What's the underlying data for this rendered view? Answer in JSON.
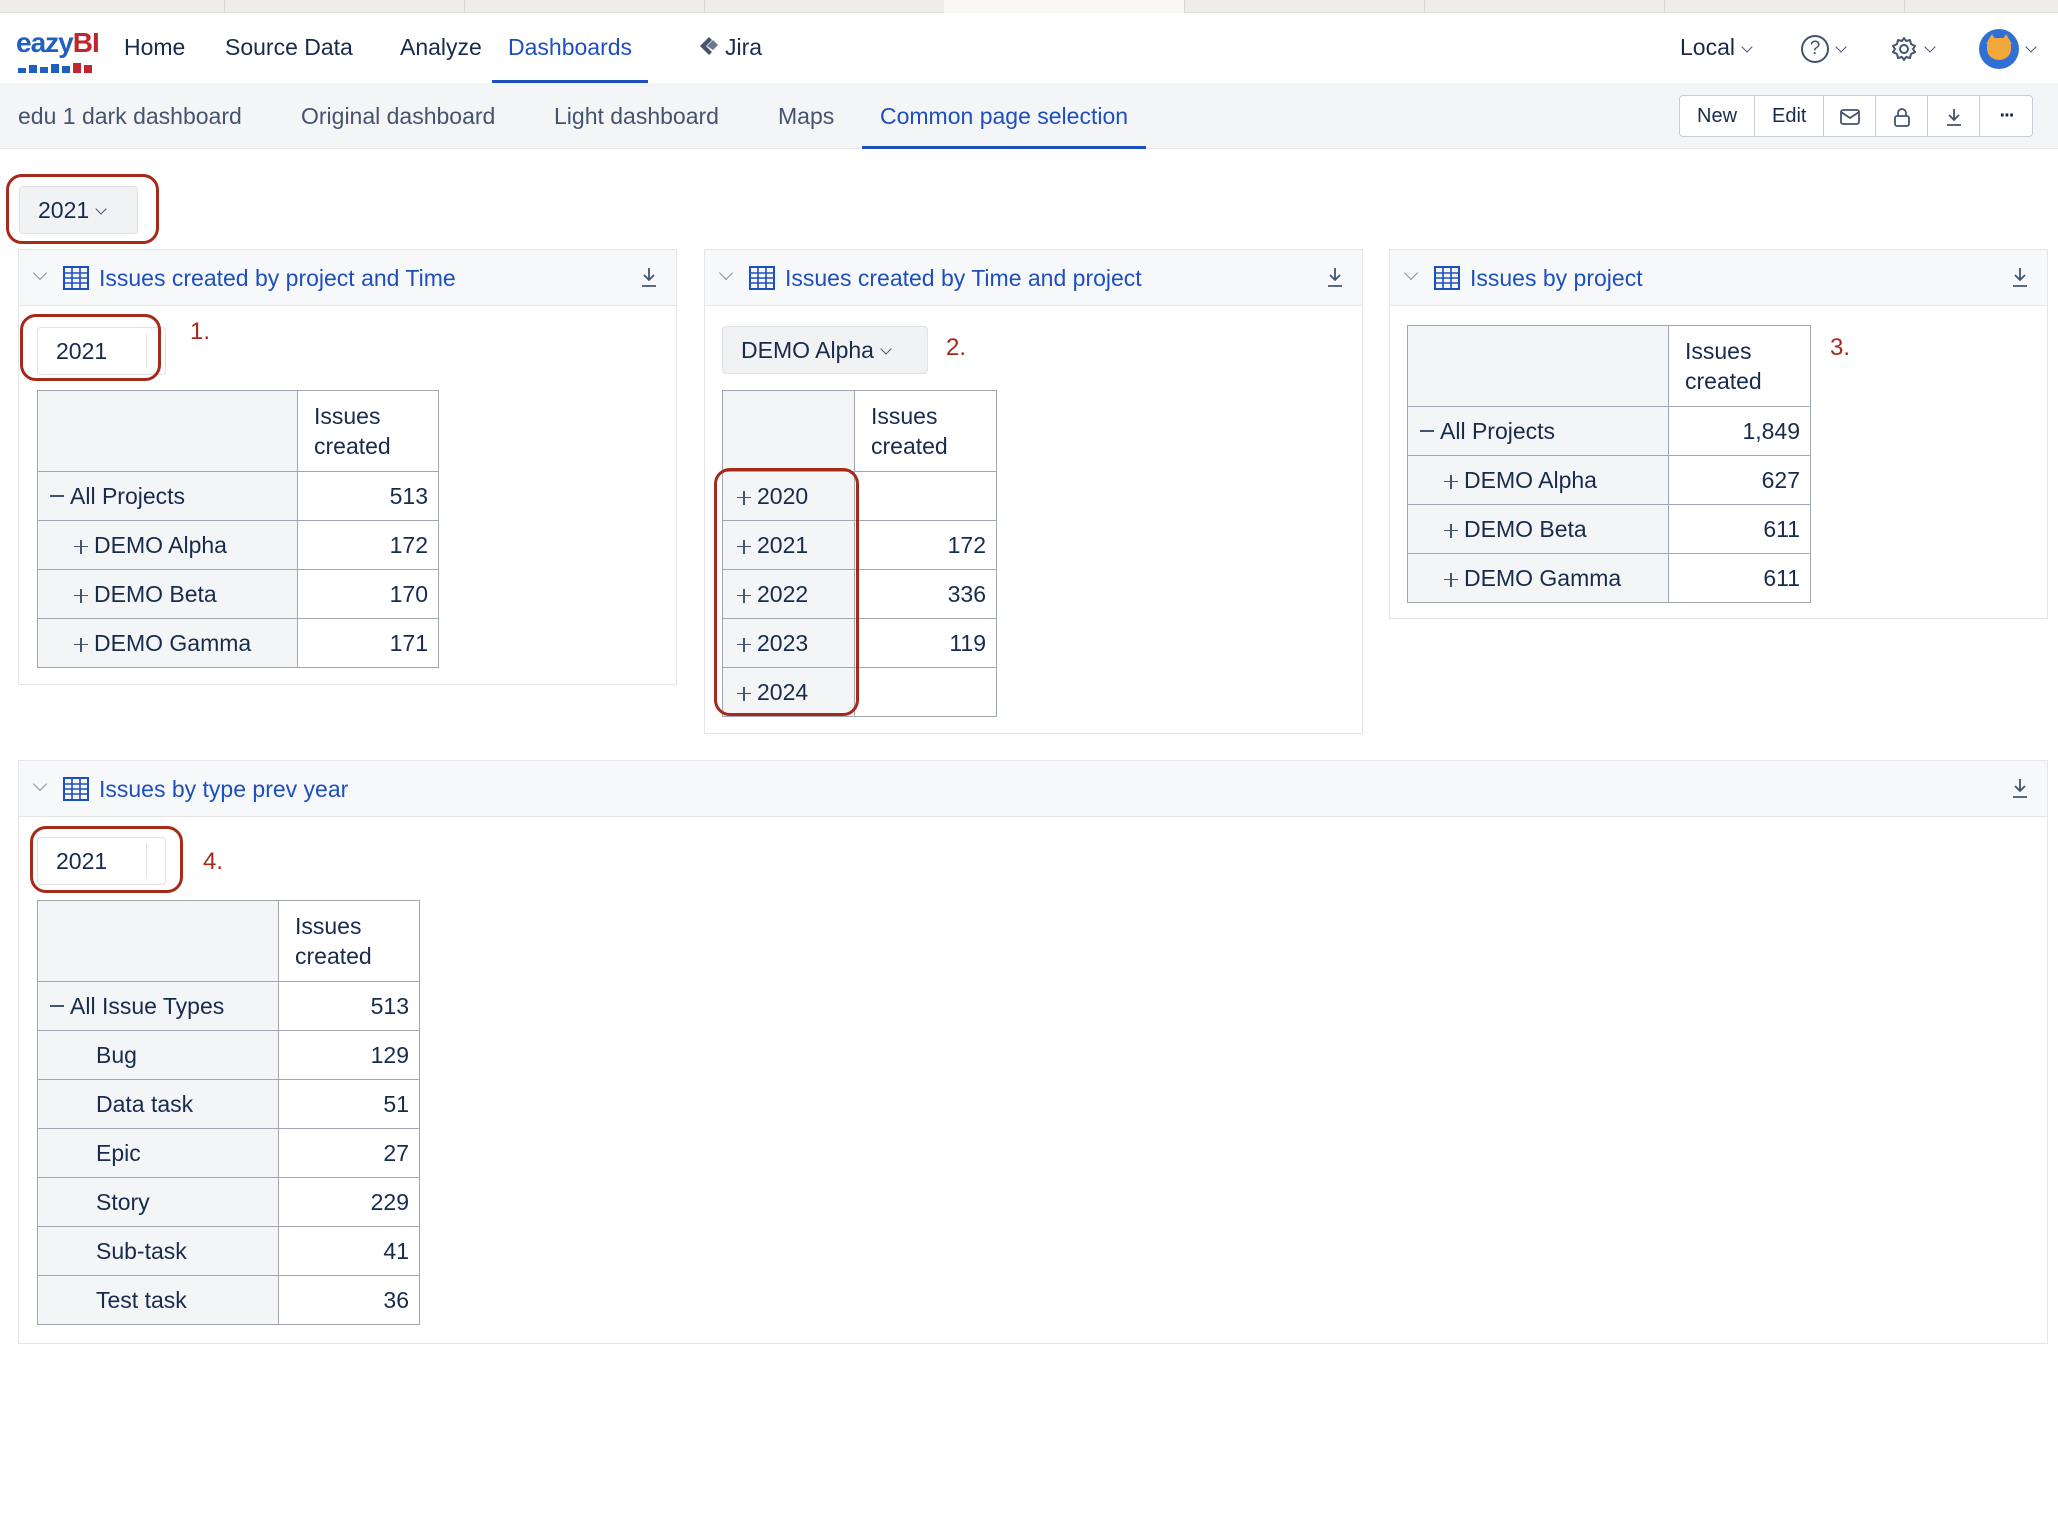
{
  "nav": {
    "logo_text": {
      "ea": "ea",
      "zy": "zy",
      "bi": "BI"
    },
    "items": [
      {
        "label": "Home"
      },
      {
        "label": "Source Data"
      },
      {
        "label": "Analyze"
      },
      {
        "label": "Dashboards",
        "active": true
      },
      {
        "label": "Jira"
      }
    ],
    "account": {
      "label": "Local"
    },
    "icons": {
      "help": "help-icon",
      "settings": "gear-icon",
      "avatar": "avatar"
    }
  },
  "subnav": {
    "tabs": [
      {
        "label": "edu 1 dark dashboard"
      },
      {
        "label": "Original dashboard"
      },
      {
        "label": "Light dashboard"
      },
      {
        "label": "Maps"
      },
      {
        "label": "Common page selection",
        "active": true
      }
    ],
    "toolbar": {
      "new_label": "New",
      "edit_label": "Edit",
      "more_label": "···"
    }
  },
  "page_filter": {
    "value": "2021"
  },
  "panels": {
    "p1": {
      "title": "Issues created by project and Time",
      "filter": "2021",
      "step": "1.",
      "header": {
        "col": "Issues created"
      },
      "rows": [
        {
          "label": "All Projects",
          "value": "513"
        },
        {
          "label": "DEMO Alpha",
          "value": "172"
        },
        {
          "label": "DEMO Beta",
          "value": "170"
        },
        {
          "label": "DEMO Gamma",
          "value": "171"
        }
      ]
    },
    "p2": {
      "title": "Issues created by Time and project",
      "filter": "DEMO Alpha",
      "step": "2.",
      "header": {
        "col": "Issues created"
      },
      "rows": [
        {
          "label": "2020",
          "value": ""
        },
        {
          "label": "2021",
          "value": "172"
        },
        {
          "label": "2022",
          "value": "336"
        },
        {
          "label": "2023",
          "value": "119"
        },
        {
          "label": "2024",
          "value": ""
        }
      ]
    },
    "p3": {
      "title": "Issues by project",
      "step": "3.",
      "header": {
        "col": "Issues created"
      },
      "rows": [
        {
          "label": "All Projects",
          "value": "1,849"
        },
        {
          "label": "DEMO Alpha",
          "value": "627"
        },
        {
          "label": "DEMO Beta",
          "value": "611"
        },
        {
          "label": "DEMO Gamma",
          "value": "611"
        }
      ]
    },
    "p4": {
      "title": "Issues by type prev year",
      "filter": "2021",
      "step": "4.",
      "header": {
        "col": "Issues created"
      },
      "rows": [
        {
          "label": "All Issue Types",
          "value": "513"
        },
        {
          "label": "Bug",
          "value": "129"
        },
        {
          "label": "Data task",
          "value": "51"
        },
        {
          "label": "Epic",
          "value": "27"
        },
        {
          "label": "Story",
          "value": "229"
        },
        {
          "label": "Sub-task",
          "value": "41"
        },
        {
          "label": "Test task",
          "value": "36"
        }
      ]
    }
  },
  "colors": {
    "accent": "#1d4fbf",
    "annotation": "#a52a1a",
    "brand_red": "#c0262d"
  }
}
